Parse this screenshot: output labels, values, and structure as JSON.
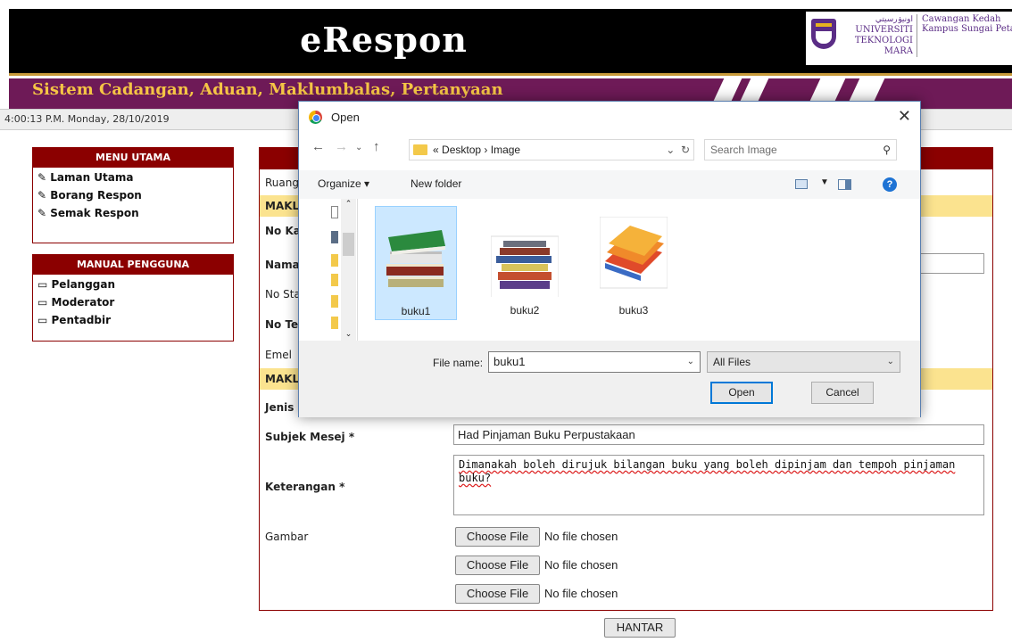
{
  "header": {
    "app_title": "eRespon",
    "banner": "Sistem Cadangan, Aduan, Maklumbalas, Pertanyaan",
    "logo": {
      "jawi": "اونيۏرسيتي",
      "line1": "UNIVERSITI",
      "line2": "TEKNOLOGI",
      "line3": "MARA",
      "campus1": "Cawangan Kedah",
      "campus2": "Kampus Sungai Petani"
    },
    "clock": "4:00:13 P.M. Monday, 28/10/2019"
  },
  "menu_utama": {
    "title": "MENU UTAMA",
    "items": [
      "Laman Utama",
      "Borang Respon",
      "Semak Respon"
    ]
  },
  "manual": {
    "title": "MANUAL PENGGUNA",
    "items": [
      "Pelanggan",
      "Moderator",
      "Pentadbir"
    ]
  },
  "form": {
    "ruang": "Ruang",
    "section1": "MAKL",
    "no_ka": "No Ka",
    "nama": "Nama",
    "no_sta": "No Sta",
    "no_tel": "No Te",
    "emel": "Emel",
    "section2": "MAKL",
    "jenis": "Jenis",
    "subjek_label": "Subjek Mesej *",
    "subjek_value": "Had Pinjaman Buku Perpustakaan",
    "keterangan_label": "Keterangan *",
    "keterangan_value": "Dimanakah boleh dirujuk bilangan buku yang boleh dipinjam dan tempoh pinjaman buku?",
    "gambar_label": "Gambar",
    "choose_file": "Choose File",
    "no_file": "No file chosen",
    "submit": "HANTAR"
  },
  "dialog": {
    "title": "Open",
    "path_prefix": "«",
    "path": [
      "Desktop",
      "Image"
    ],
    "search_placeholder": "Search Image",
    "organize": "Organize ▾",
    "new_folder": "New folder",
    "files": [
      "buku1",
      "buku2",
      "buku3"
    ],
    "file_name_label": "File name:",
    "file_name_value": "buku1",
    "filter": "All Files",
    "open": "Open",
    "cancel": "Cancel"
  },
  "colors": {
    "maroon": "#8b0000",
    "banner": "#6e1a57",
    "banner_text": "#f5c545",
    "section": "#fbe38f"
  }
}
